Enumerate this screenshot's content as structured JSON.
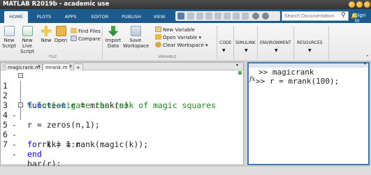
{
  "window": {
    "title": "MATLAB R2019b - academic use"
  },
  "tabs": [
    {
      "label": "HOME"
    },
    {
      "label": "PLOTS"
    },
    {
      "label": "APPS"
    },
    {
      "label": "EDITOR"
    },
    {
      "label": "PUBLISH"
    },
    {
      "label": "VIEW"
    }
  ],
  "search": {
    "placeholder": "Search Documentation"
  },
  "signin": {
    "label": "Sign In"
  },
  "ribbon": {
    "file": {
      "group_label": "FILE",
      "new_script": "New Script",
      "new_live_script": "New Live Script",
      "new": "New",
      "open": "Open",
      "find_files": "Find Files",
      "compare": "Compare"
    },
    "variable": {
      "group_label": "VARIABLE",
      "import_data": "Import Data",
      "save_workspace": "Save Workspace",
      "new_variable": "New Variable",
      "open_variable": "Open Variable",
      "clear_workspace": "Clear Workspace"
    },
    "code": "CODE",
    "simulink": "SIMULINK",
    "environment": "ENVIRONMENT",
    "resources": "RESOURCES"
  },
  "editor": {
    "tabs": [
      {
        "label": "magicrank.m"
      },
      {
        "label": "mrank.m"
      }
    ],
    "add_tab": "+",
    "lines": [
      {
        "num": "1",
        "dash": "",
        "kw": "function",
        "rest": " r = mrank(n)"
      },
      {
        "num": "2",
        "dash": "",
        "comment": "% Investigate the rank of magic squares"
      },
      {
        "num": "3",
        "dash": "-",
        "rest": "r = zeros(n,1);"
      },
      {
        "num": "4",
        "dash": "-",
        "kw": "for",
        "rest": " k = 1:n"
      },
      {
        "num": "5",
        "dash": "-",
        "rest": "   r(k) = rank(magic(k));"
      },
      {
        "num": "6",
        "dash": "-",
        "kw": "end",
        "rest": ""
      },
      {
        "num": "7",
        "dash": "-",
        "rest": "bar(r);"
      }
    ]
  },
  "command_window": {
    "fx": "fx",
    "lines": [
      {
        "text": ">> magicrank"
      },
      {
        "text": ">> r = mrank(100);"
      }
    ]
  }
}
